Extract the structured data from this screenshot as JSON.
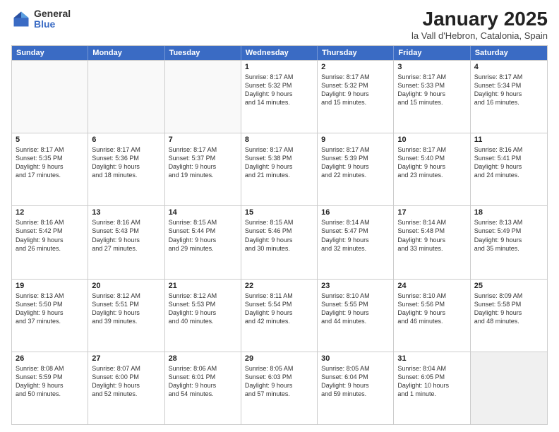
{
  "logo": {
    "general": "General",
    "blue": "Blue"
  },
  "title": "January 2025",
  "subtitle": "la Vall d'Hebron, Catalonia, Spain",
  "days": [
    "Sunday",
    "Monday",
    "Tuesday",
    "Wednesday",
    "Thursday",
    "Friday",
    "Saturday"
  ],
  "weeks": [
    [
      {
        "day": "",
        "info": ""
      },
      {
        "day": "",
        "info": ""
      },
      {
        "day": "",
        "info": ""
      },
      {
        "day": "1",
        "info": "Sunrise: 8:17 AM\nSunset: 5:32 PM\nDaylight: 9 hours\nand 14 minutes."
      },
      {
        "day": "2",
        "info": "Sunrise: 8:17 AM\nSunset: 5:32 PM\nDaylight: 9 hours\nand 15 minutes."
      },
      {
        "day": "3",
        "info": "Sunrise: 8:17 AM\nSunset: 5:33 PM\nDaylight: 9 hours\nand 15 minutes."
      },
      {
        "day": "4",
        "info": "Sunrise: 8:17 AM\nSunset: 5:34 PM\nDaylight: 9 hours\nand 16 minutes."
      }
    ],
    [
      {
        "day": "5",
        "info": "Sunrise: 8:17 AM\nSunset: 5:35 PM\nDaylight: 9 hours\nand 17 minutes."
      },
      {
        "day": "6",
        "info": "Sunrise: 8:17 AM\nSunset: 5:36 PM\nDaylight: 9 hours\nand 18 minutes."
      },
      {
        "day": "7",
        "info": "Sunrise: 8:17 AM\nSunset: 5:37 PM\nDaylight: 9 hours\nand 19 minutes."
      },
      {
        "day": "8",
        "info": "Sunrise: 8:17 AM\nSunset: 5:38 PM\nDaylight: 9 hours\nand 21 minutes."
      },
      {
        "day": "9",
        "info": "Sunrise: 8:17 AM\nSunset: 5:39 PM\nDaylight: 9 hours\nand 22 minutes."
      },
      {
        "day": "10",
        "info": "Sunrise: 8:17 AM\nSunset: 5:40 PM\nDaylight: 9 hours\nand 23 minutes."
      },
      {
        "day": "11",
        "info": "Sunrise: 8:16 AM\nSunset: 5:41 PM\nDaylight: 9 hours\nand 24 minutes."
      }
    ],
    [
      {
        "day": "12",
        "info": "Sunrise: 8:16 AM\nSunset: 5:42 PM\nDaylight: 9 hours\nand 26 minutes."
      },
      {
        "day": "13",
        "info": "Sunrise: 8:16 AM\nSunset: 5:43 PM\nDaylight: 9 hours\nand 27 minutes."
      },
      {
        "day": "14",
        "info": "Sunrise: 8:15 AM\nSunset: 5:44 PM\nDaylight: 9 hours\nand 29 minutes."
      },
      {
        "day": "15",
        "info": "Sunrise: 8:15 AM\nSunset: 5:46 PM\nDaylight: 9 hours\nand 30 minutes."
      },
      {
        "day": "16",
        "info": "Sunrise: 8:14 AM\nSunset: 5:47 PM\nDaylight: 9 hours\nand 32 minutes."
      },
      {
        "day": "17",
        "info": "Sunrise: 8:14 AM\nSunset: 5:48 PM\nDaylight: 9 hours\nand 33 minutes."
      },
      {
        "day": "18",
        "info": "Sunrise: 8:13 AM\nSunset: 5:49 PM\nDaylight: 9 hours\nand 35 minutes."
      }
    ],
    [
      {
        "day": "19",
        "info": "Sunrise: 8:13 AM\nSunset: 5:50 PM\nDaylight: 9 hours\nand 37 minutes."
      },
      {
        "day": "20",
        "info": "Sunrise: 8:12 AM\nSunset: 5:51 PM\nDaylight: 9 hours\nand 39 minutes."
      },
      {
        "day": "21",
        "info": "Sunrise: 8:12 AM\nSunset: 5:53 PM\nDaylight: 9 hours\nand 40 minutes."
      },
      {
        "day": "22",
        "info": "Sunrise: 8:11 AM\nSunset: 5:54 PM\nDaylight: 9 hours\nand 42 minutes."
      },
      {
        "day": "23",
        "info": "Sunrise: 8:10 AM\nSunset: 5:55 PM\nDaylight: 9 hours\nand 44 minutes."
      },
      {
        "day": "24",
        "info": "Sunrise: 8:10 AM\nSunset: 5:56 PM\nDaylight: 9 hours\nand 46 minutes."
      },
      {
        "day": "25",
        "info": "Sunrise: 8:09 AM\nSunset: 5:58 PM\nDaylight: 9 hours\nand 48 minutes."
      }
    ],
    [
      {
        "day": "26",
        "info": "Sunrise: 8:08 AM\nSunset: 5:59 PM\nDaylight: 9 hours\nand 50 minutes."
      },
      {
        "day": "27",
        "info": "Sunrise: 8:07 AM\nSunset: 6:00 PM\nDaylight: 9 hours\nand 52 minutes."
      },
      {
        "day": "28",
        "info": "Sunrise: 8:06 AM\nSunset: 6:01 PM\nDaylight: 9 hours\nand 54 minutes."
      },
      {
        "day": "29",
        "info": "Sunrise: 8:05 AM\nSunset: 6:03 PM\nDaylight: 9 hours\nand 57 minutes."
      },
      {
        "day": "30",
        "info": "Sunrise: 8:05 AM\nSunset: 6:04 PM\nDaylight: 9 hours\nand 59 minutes."
      },
      {
        "day": "31",
        "info": "Sunrise: 8:04 AM\nSunset: 6:05 PM\nDaylight: 10 hours\nand 1 minute."
      },
      {
        "day": "",
        "info": ""
      }
    ]
  ]
}
